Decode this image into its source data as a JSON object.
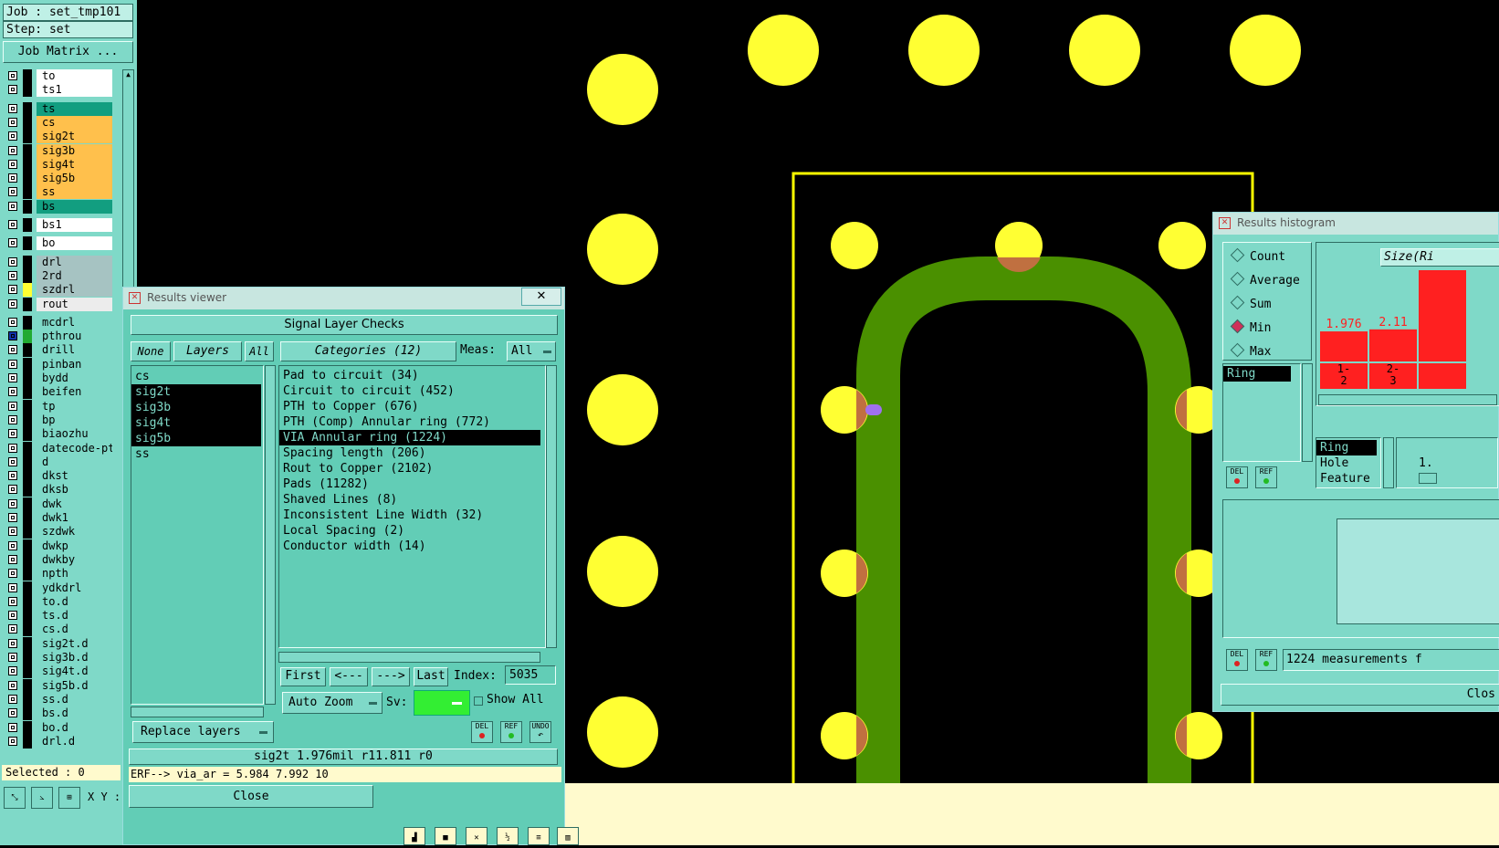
{
  "job": {
    "job_line": "Job : set_tmp101",
    "step_line": "Step: set",
    "matrix_button": "Job Matrix ..."
  },
  "colors": {
    "canvas_bg": "#000000",
    "pad": "#ffff33",
    "trace": "#4a9000",
    "outline": "#ffff00",
    "panel": "#7fd9c8",
    "marker": "#a070f0",
    "overlap": "#c07040"
  },
  "layers": [
    {
      "name": "to",
      "color": "#ffffff"
    },
    {
      "name": "ts1",
      "color": "#ffffff"
    },
    {
      "name": "ts",
      "color": "#129e80"
    },
    {
      "name": "cs",
      "color": "#ffc04c"
    },
    {
      "name": "sig2t",
      "color": "#ffc04c"
    },
    {
      "name": "sig3b",
      "color": "#ffc04c"
    },
    {
      "name": "sig4t",
      "color": "#ffc04c"
    },
    {
      "name": "sig5b",
      "color": "#ffc04c"
    },
    {
      "name": "ss",
      "color": "#ffc04c"
    },
    {
      "name": "bs",
      "color": "#129e80"
    },
    {
      "name": "bs1",
      "color": "#ffffff"
    },
    {
      "name": "bo",
      "color": "#ffffff"
    },
    {
      "name": "drl",
      "color": "#a6c3c2"
    },
    {
      "name": "2rd",
      "color": "#a6c3c2"
    },
    {
      "name": "szdrl",
      "color": "#a6c3c2"
    },
    {
      "name": "rout",
      "color": "#ececec"
    },
    {
      "name": "mcdrl",
      "color": "#7fd9c8"
    },
    {
      "name": "pthrou",
      "color": "#7fd9c8"
    },
    {
      "name": "drill",
      "color": "#7fd9c8"
    },
    {
      "name": "pinban",
      "color": "#7fd9c8"
    },
    {
      "name": "bydd",
      "color": "#7fd9c8"
    },
    {
      "name": "beifen",
      "color": "#7fd9c8"
    },
    {
      "name": "tp",
      "color": "#7fd9c8"
    },
    {
      "name": "bp",
      "color": "#7fd9c8"
    },
    {
      "name": "biaozhu",
      "color": "#7fd9c8"
    },
    {
      "name": "datecode-pt",
      "color": "#7fd9c8"
    },
    {
      "name": "d",
      "color": "#7fd9c8"
    },
    {
      "name": "dkst",
      "color": "#7fd9c8"
    },
    {
      "name": "dksb",
      "color": "#7fd9c8"
    },
    {
      "name": "dwk",
      "color": "#7fd9c8"
    },
    {
      "name": "dwk1",
      "color": "#7fd9c8"
    },
    {
      "name": "szdwk",
      "color": "#7fd9c8"
    },
    {
      "name": "dwkp",
      "color": "#7fd9c8"
    },
    {
      "name": "dwkby",
      "color": "#7fd9c8"
    },
    {
      "name": "npth",
      "color": "#7fd9c8"
    },
    {
      "name": "ydkdrl",
      "color": "#7fd9c8"
    },
    {
      "name": "to.d",
      "color": "#7fd9c8"
    },
    {
      "name": "ts.d",
      "color": "#7fd9c8"
    },
    {
      "name": "cs.d",
      "color": "#7fd9c8"
    },
    {
      "name": "sig2t.d",
      "color": "#7fd9c8"
    },
    {
      "name": "sig3b.d",
      "color": "#7fd9c8"
    },
    {
      "name": "sig4t.d",
      "color": "#7fd9c8"
    },
    {
      "name": "sig5b.d",
      "color": "#7fd9c8"
    },
    {
      "name": "ss.d",
      "color": "#7fd9c8"
    },
    {
      "name": "bs.d",
      "color": "#7fd9c8"
    },
    {
      "name": "bo.d",
      "color": "#7fd9c8"
    },
    {
      "name": "drl.d",
      "color": "#7fd9c8"
    }
  ],
  "selected_status": "Selected : 0",
  "xy_label": "X Y :",
  "viewer": {
    "title": "Results viewer",
    "close_x": "✕",
    "header": "Signal Layer Checks",
    "none_button": "None",
    "layers_tab": "Layers",
    "all_button": "All",
    "layer_items": [
      "cs",
      "sig2t",
      "sig3b",
      "sig4t",
      "sig5b",
      "ss"
    ],
    "categories_tab": "Categories (12)",
    "meas_label": "Meas:",
    "meas_value": "All",
    "categories": [
      "Pad to circuit (34)",
      "Circuit to circuit (452)",
      "PTH to Copper (676)",
      "PTH (Comp) Annular ring (772)",
      "VIA Annular ring (1224)",
      "Spacing length (206)",
      "Rout to Copper (2102)",
      "Pads (11282)",
      "Shaved Lines (8)",
      "Inconsistent Line Width (32)",
      "Local Spacing (2)",
      "Conductor width (14)"
    ],
    "first_button": "First",
    "prev_button": "<---",
    "next_button": "--->",
    "last_button": "Last",
    "index_label": "Index:",
    "index_value": "5035",
    "auto_zoom": "Auto Zoom",
    "sv_label": "Sv:",
    "show_all": "Show All",
    "replace_layers": "Replace layers",
    "del_label": "DEL",
    "ref_label": "REF",
    "undo_label": "UNDO",
    "status": "sig2t 1.976mil   r11.811  r0",
    "erf_line": "ERF--> via_ar = 5.984 7.992 10",
    "close_button": "Close"
  },
  "histogram": {
    "title": "Results histogram",
    "modes": [
      {
        "label": "Count",
        "on": false
      },
      {
        "label": "Average",
        "on": false
      },
      {
        "label": "Sum",
        "on": false
      },
      {
        "label": "Min",
        "on": true
      },
      {
        "label": "Max",
        "on": false
      }
    ],
    "size_label": "Size(Ri",
    "measure_list": [
      "Ring"
    ],
    "axis_list": [
      "Ring",
      "Hole",
      "Feature"
    ],
    "slider_value": "1.",
    "summary": "1224 measurements f",
    "close_button": "Clos",
    "del_label": "DEL",
    "ref_label": "REF"
  },
  "chart_data": {
    "type": "bar",
    "categories": [
      "1-2",
      "2-3",
      ""
    ],
    "values": [
      1.976,
      2.11,
      null
    ],
    "data_labels": [
      "1.976",
      "2.11"
    ],
    "bar_color": "#ff2020"
  }
}
